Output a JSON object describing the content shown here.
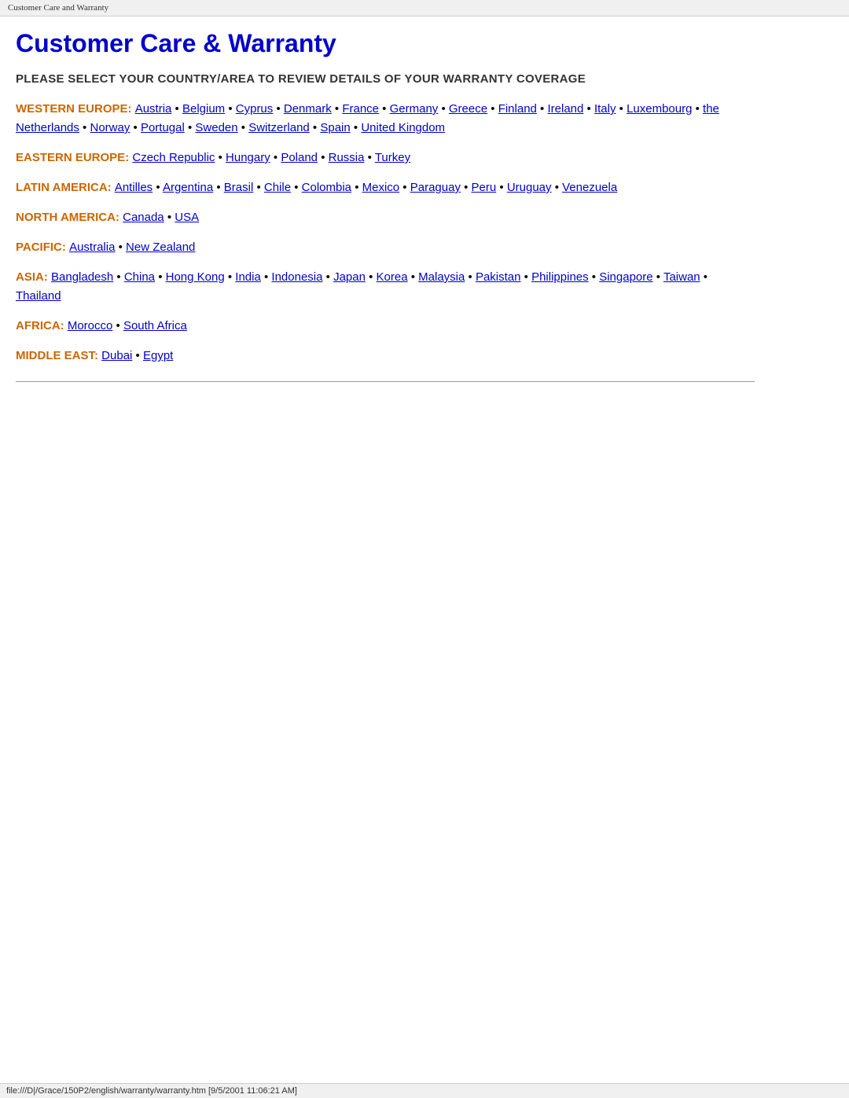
{
  "browser_tab": {
    "label": "Customer Care and Warranty"
  },
  "page": {
    "title": "Customer Care & Warranty",
    "subtitle": "PLEASE SELECT YOUR COUNTRY/AREA TO REVIEW DETAILS OF YOUR WARRANTY COVERAGE"
  },
  "regions": [
    {
      "id": "western-europe",
      "label": "WESTERN EUROPE:",
      "countries": [
        {
          "name": "Austria",
          "href": "#"
        },
        {
          "name": "Belgium",
          "href": "#"
        },
        {
          "name": "Cyprus",
          "href": "#"
        },
        {
          "name": "Denmark",
          "href": "#"
        },
        {
          "name": "France",
          "href": "#"
        },
        {
          "name": "Germany",
          "href": "#"
        },
        {
          "name": "Greece",
          "href": "#"
        },
        {
          "name": "Finland",
          "href": "#"
        },
        {
          "name": "Ireland",
          "href": "#"
        },
        {
          "name": "Italy",
          "href": "#"
        },
        {
          "name": "Luxembourg",
          "href": "#"
        },
        {
          "name": "the Netherlands",
          "href": "#"
        },
        {
          "name": "Norway",
          "href": "#"
        },
        {
          "name": "Portugal",
          "href": "#"
        },
        {
          "name": "Sweden",
          "href": "#"
        },
        {
          "name": "Switzerland",
          "href": "#"
        },
        {
          "name": "Spain",
          "href": "#"
        },
        {
          "name": "United Kingdom",
          "href": "#"
        }
      ]
    },
    {
      "id": "eastern-europe",
      "label": "EASTERN EUROPE:",
      "countries": [
        {
          "name": "Czech Republic",
          "href": "#"
        },
        {
          "name": "Hungary",
          "href": "#"
        },
        {
          "name": "Poland",
          "href": "#"
        },
        {
          "name": "Russia",
          "href": "#"
        },
        {
          "name": "Turkey",
          "href": "#"
        }
      ]
    },
    {
      "id": "latin-america",
      "label": "LATIN AMERICA:",
      "countries": [
        {
          "name": "Antilles",
          "href": "#"
        },
        {
          "name": "Argentina",
          "href": "#"
        },
        {
          "name": "Brasil",
          "href": "#"
        },
        {
          "name": "Chile",
          "href": "#"
        },
        {
          "name": "Colombia",
          "href": "#"
        },
        {
          "name": "Mexico",
          "href": "#"
        },
        {
          "name": "Paraguay",
          "href": "#"
        },
        {
          "name": "Peru",
          "href": "#"
        },
        {
          "name": "Uruguay",
          "href": "#"
        },
        {
          "name": "Venezuela",
          "href": "#"
        }
      ]
    },
    {
      "id": "north-america",
      "label": "NORTH AMERICA:",
      "countries": [
        {
          "name": "Canada",
          "href": "#"
        },
        {
          "name": "USA",
          "href": "#"
        }
      ]
    },
    {
      "id": "pacific",
      "label": "PACIFIC:",
      "countries": [
        {
          "name": "Australia",
          "href": "#"
        },
        {
          "name": "New Zealand",
          "href": "#"
        }
      ]
    },
    {
      "id": "asia",
      "label": "ASIA:",
      "countries": [
        {
          "name": "Bangladesh",
          "href": "#"
        },
        {
          "name": "China",
          "href": "#"
        },
        {
          "name": "Hong Kong",
          "href": "#"
        },
        {
          "name": "India",
          "href": "#"
        },
        {
          "name": "Indonesia",
          "href": "#"
        },
        {
          "name": "Japan",
          "href": "#"
        },
        {
          "name": "Korea",
          "href": "#"
        },
        {
          "name": "Malaysia",
          "href": "#"
        },
        {
          "name": "Pakistan",
          "href": "#"
        },
        {
          "name": "Philippines",
          "href": "#"
        },
        {
          "name": "Singapore",
          "href": "#"
        },
        {
          "name": "Taiwan",
          "href": "#"
        },
        {
          "name": "Thailand",
          "href": "#"
        }
      ]
    },
    {
      "id": "africa",
      "label": "AFRICA:",
      "countries": [
        {
          "name": "Morocco",
          "href": "#"
        },
        {
          "name": "South Africa",
          "href": "#"
        }
      ]
    },
    {
      "id": "middle-east",
      "label": "MIDDLE EAST:",
      "countries": [
        {
          "name": "Dubai",
          "href": "#"
        },
        {
          "name": "Egypt",
          "href": "#"
        }
      ]
    }
  ],
  "status_bar": {
    "text": "file:///D|/Grace/150P2/english/warranty/warranty.htm [9/5/2001 11:06:21 AM]"
  }
}
